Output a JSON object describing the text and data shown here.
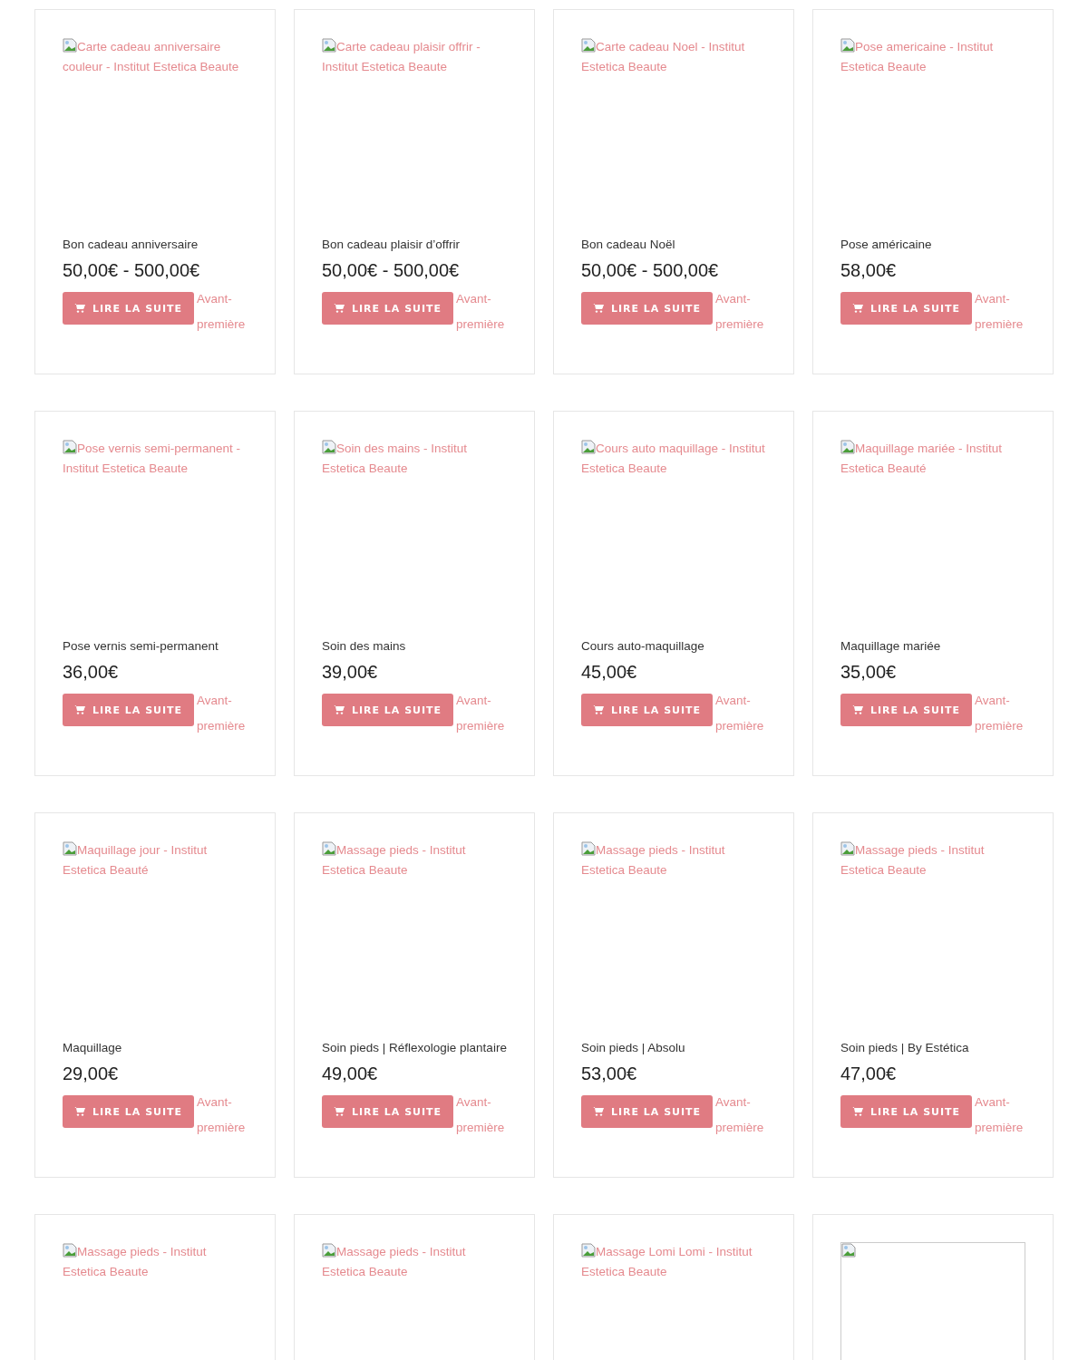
{
  "products": [
    {
      "image": {
        "kind": "alt_text",
        "alt": "Carte cadeau anniversaire couleur - Institut Estetica Beaute"
      },
      "name": "Bon cadeau anniversaire",
      "price": "50,00€ - 500,00€",
      "button": "LIRE LA SUITE",
      "link": "Avant-première"
    },
    {
      "image": {
        "kind": "alt_text",
        "alt": "Carte cadeau plaisir offrir - Institut Estetica Beaute"
      },
      "name": "Bon cadeau plaisir d’offrir",
      "price": "50,00€ - 500,00€",
      "button": "LIRE LA SUITE",
      "link": "Avant-première"
    },
    {
      "image": {
        "kind": "alt_text",
        "alt": "Carte cadeau Noel - Institut Estetica Beaute"
      },
      "name": "Bon cadeau Noël",
      "price": "50,00€ - 500,00€",
      "button": "LIRE LA SUITE",
      "link": "Avant-première"
    },
    {
      "image": {
        "kind": "alt_text",
        "alt": "Pose americaine - Institut Estetica Beaute"
      },
      "name": "Pose américaine",
      "price": "58,00€",
      "button": "LIRE LA SUITE",
      "link": "Avant-première"
    },
    {
      "image": {
        "kind": "alt_text",
        "alt": "Pose vernis semi-permanent - Institut Estetica Beaute"
      },
      "name": "Pose vernis semi-permanent",
      "price": "36,00€",
      "button": "LIRE LA SUITE",
      "link": "Avant-première"
    },
    {
      "image": {
        "kind": "alt_text",
        "alt": "Soin des mains - Institut Estetica Beaute"
      },
      "name": "Soin des mains",
      "price": "39,00€",
      "button": "LIRE LA SUITE",
      "link": "Avant-première"
    },
    {
      "image": {
        "kind": "alt_text",
        "alt": "Cours auto maquillage - Institut Estetica Beaute"
      },
      "name": "Cours auto-maquillage",
      "price": "45,00€",
      "button": "LIRE LA SUITE",
      "link": "Avant-première"
    },
    {
      "image": {
        "kind": "alt_text",
        "alt": "Maquillage mariée - Institut Estetica Beauté"
      },
      "name": "Maquillage mariée",
      "price": "35,00€",
      "button": "LIRE LA SUITE",
      "link": "Avant-première"
    },
    {
      "image": {
        "kind": "alt_text",
        "alt": "Maquillage jour - Institut Estetica Beauté"
      },
      "name": "Maquillage",
      "price": "29,00€",
      "button": "LIRE LA SUITE",
      "link": "Avant-première"
    },
    {
      "image": {
        "kind": "alt_text",
        "alt": "Massage pieds - Institut Estetica Beaute"
      },
      "name": "Soin pieds | Réflexologie plantaire",
      "price": "49,00€",
      "button": "LIRE LA SUITE",
      "link": "Avant-première"
    },
    {
      "image": {
        "kind": "alt_text",
        "alt": "Massage pieds - Institut Estetica Beaute"
      },
      "name": "Soin pieds | Absolu",
      "price": "53,00€",
      "button": "LIRE LA SUITE",
      "link": "Avant-première"
    },
    {
      "image": {
        "kind": "alt_text",
        "alt": "Massage pieds - Institut Estetica Beaute"
      },
      "name": "Soin pieds | By Estética",
      "price": "47,00€",
      "button": "LIRE LA SUITE",
      "link": "Avant-première"
    },
    {
      "image": {
        "kind": "alt_text",
        "alt": "Massage pieds - Institut Estetica Beaute"
      }
    },
    {
      "image": {
        "kind": "alt_text",
        "alt": "Massage pieds - Institut Estetica Beaute"
      }
    },
    {
      "image": {
        "kind": "alt_text",
        "alt": "Massage Lomi Lomi - Institut Estetica Beaute"
      }
    },
    {
      "image": {
        "kind": "frame"
      }
    }
  ]
}
